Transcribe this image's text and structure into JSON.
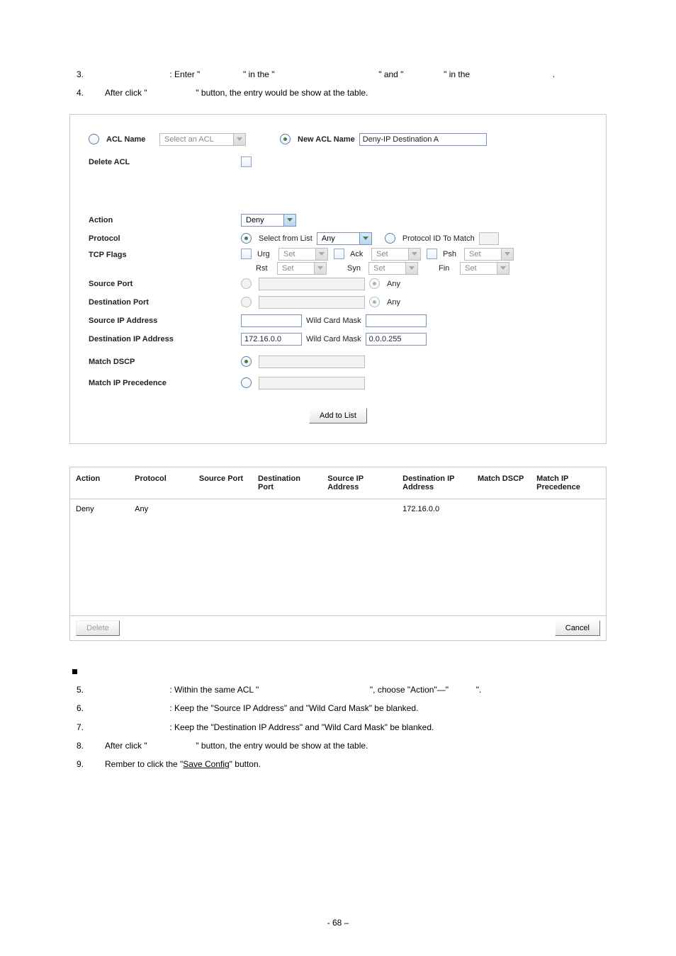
{
  "steps_top": [
    {
      "n": "3.",
      "lead": "",
      "t1": ": Enter \"",
      "t2": "\" in the \"",
      "t3": "\" and \"",
      "t4": "\" in the",
      "t5": "."
    },
    {
      "n": "4.",
      "lead": "After click \"",
      "t1": "\" button, the entry would be show at the table."
    }
  ],
  "panel": {
    "acl_name_label": "ACL Name",
    "acl_name_placeholder": "Select an ACL",
    "delete_acl_label": "Delete ACL",
    "new_acl_name_label": "New ACL Name",
    "new_acl_name_value": "Deny-IP Destination A",
    "action_label": "Action",
    "action_value": "Deny",
    "protocol_label": "Protocol",
    "protocol_select_list_label": "Select from List",
    "protocol_value": "Any",
    "protocol_id_label": "Protocol ID To Match",
    "tcp_flags_label": "TCP Flags",
    "tcp": {
      "urg": "Urg",
      "ack": "Ack",
      "psh": "Psh",
      "rst": "Rst",
      "syn": "Syn",
      "fin": "Fin",
      "set": "Set"
    },
    "source_port_label": "Source Port",
    "dest_port_label": "Destination Port",
    "any_label": "Any",
    "source_ip_label": "Source IP Address",
    "dest_ip_label": "Destination IP Address",
    "dest_ip_value": "172.16.0.0",
    "wildcard_label": "Wild Card Mask",
    "wildcard_value": "0.0.0.255",
    "match_dscp_label": "Match DSCP",
    "match_ipprec_label": "Match IP Precedence",
    "add_btn": "Add to List"
  },
  "table": {
    "headers": [
      "Action",
      "Protocol",
      "Source Port",
      "Destination Port",
      "Source IP Address",
      "Destination IP Address",
      "Match DSCP",
      "Match IP Precedence"
    ],
    "row": {
      "action": "Deny",
      "protocol": "Any",
      "sport": "",
      "dport": "",
      "sip": "",
      "dip": "172.16.0.0",
      "dscp": "",
      "ipprec": ""
    },
    "delete_btn": "Delete",
    "cancel_btn": "Cancel"
  },
  "steps_bottom_heading": "",
  "steps_bottom": [
    {
      "n": "5.",
      "t": ": Within the same ACL \"",
      "t2": "\", choose \"Action\"—\"",
      "t3": "\"."
    },
    {
      "n": "6.",
      "t": ": Keep the \"Source IP Address\" and \"Wild Card Mask\" be blanked."
    },
    {
      "n": "7.",
      "t": ": Keep the \"Destination IP Address\" and \"Wild Card Mask\" be blanked."
    },
    {
      "n": "8.",
      "lead": "After click \"",
      "t": "\" button, the entry would be show at the table."
    },
    {
      "n": "9.",
      "lead": "Rember to click the \"",
      "btn": "Save Config",
      "t": "\" button."
    }
  ],
  "page_number": "- 68 –"
}
